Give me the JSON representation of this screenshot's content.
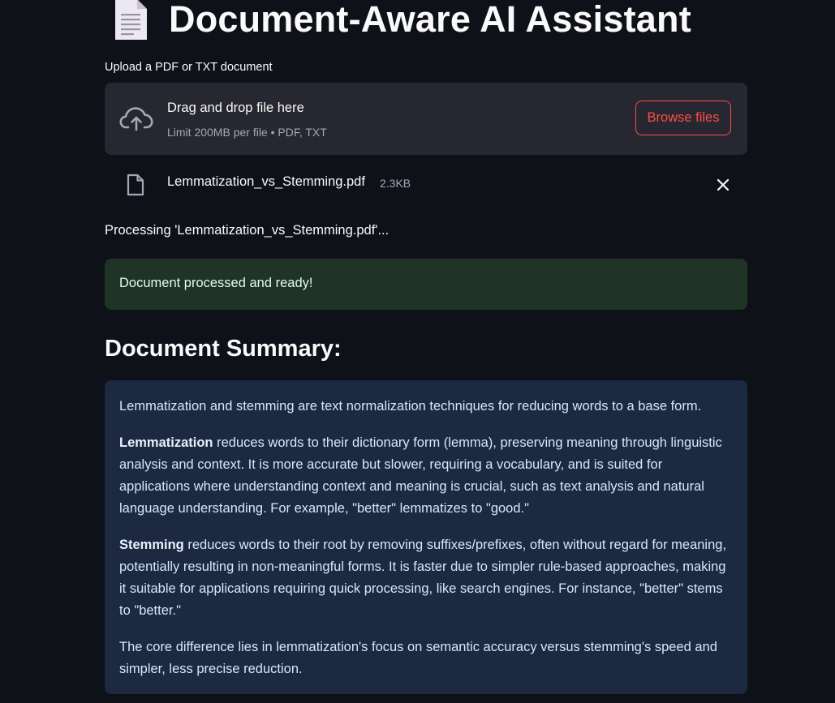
{
  "app": {
    "title": "Document-Aware AI Assistant",
    "title_icon": "document-icon"
  },
  "uploader": {
    "label": "Upload a PDF or TXT document",
    "drop_title": "Drag and drop file here",
    "limit_text": "Limit 200MB per file • PDF, TXT",
    "browse_label": "Browse files",
    "upload_icon": "cloud-upload-icon"
  },
  "uploaded_file": {
    "icon": "file-icon",
    "name": "Lemmatization_vs_Stemming.pdf",
    "size": "2.3KB",
    "remove_icon": "close-icon"
  },
  "status": {
    "processing_text": "Processing 'Lemmatization_vs_Stemming.pdf'...",
    "success_text": "Document processed and ready!"
  },
  "summary": {
    "heading": "Document Summary:",
    "intro": "Lemmatization and stemming are text normalization techniques for reducing words to a base form.",
    "lemmatization_term": "Lemmatization",
    "lemmatization_text": " reduces words to their dictionary form (lemma), preserving meaning through linguistic analysis and context. It is more accurate but slower, requiring a vocabulary, and is suited for applications where understanding context and meaning is crucial, such as text analysis and natural language understanding. For example, \"better\" lemmatizes to \"good.\"",
    "stemming_term": "Stemming",
    "stemming_text": " reduces words to their root by removing suffixes/prefixes, often without regard for meaning, potentially resulting in non-meaningful forms. It is faster due to simpler rule-based approaches, making it suitable for applications requiring quick processing, like search engines. For instance, \"better\" stems to \"better.\"",
    "conclusion": "The core difference lies in lemmatization's focus on semantic accuracy versus stemming's speed and simpler, less precise reduction."
  },
  "colors": {
    "background": "#0e1117",
    "dropzone": "#262730",
    "accent": "#ff4b4b",
    "success_bg": "#1f3327",
    "info_bg": "#1c2940"
  }
}
